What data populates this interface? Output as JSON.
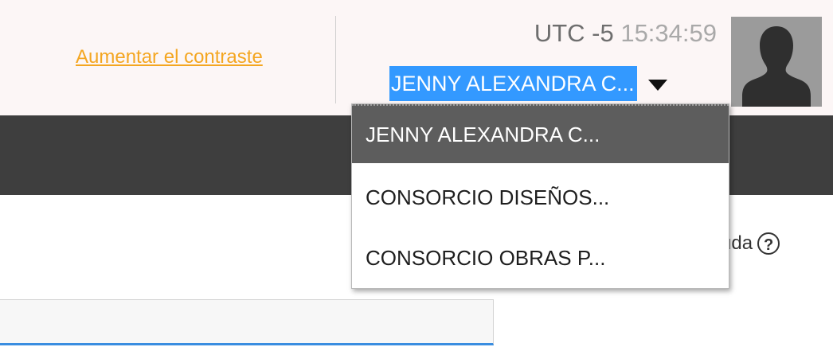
{
  "header": {
    "contrast_link": "Aumentar el contraste",
    "timezone": "UTC -5",
    "time": "15:34:59",
    "avatar_icon": "user-silhouette-icon"
  },
  "user_select": {
    "selected": "JENNY ALEXANDRA C...",
    "options": [
      "JENNY ALEXANDRA C...",
      "CONSORCIO DISEÑOS...",
      "CONSORCIO OBRAS P..."
    ],
    "selected_highlight_color": "#3399ff"
  },
  "help": {
    "label_partial": "uda",
    "icon": "help-circle-icon"
  },
  "search": {
    "value": ""
  },
  "colors": {
    "link": "#f4a621",
    "nav_band": "#3e3e3e",
    "dropdown_active": "#5d5d5d"
  }
}
